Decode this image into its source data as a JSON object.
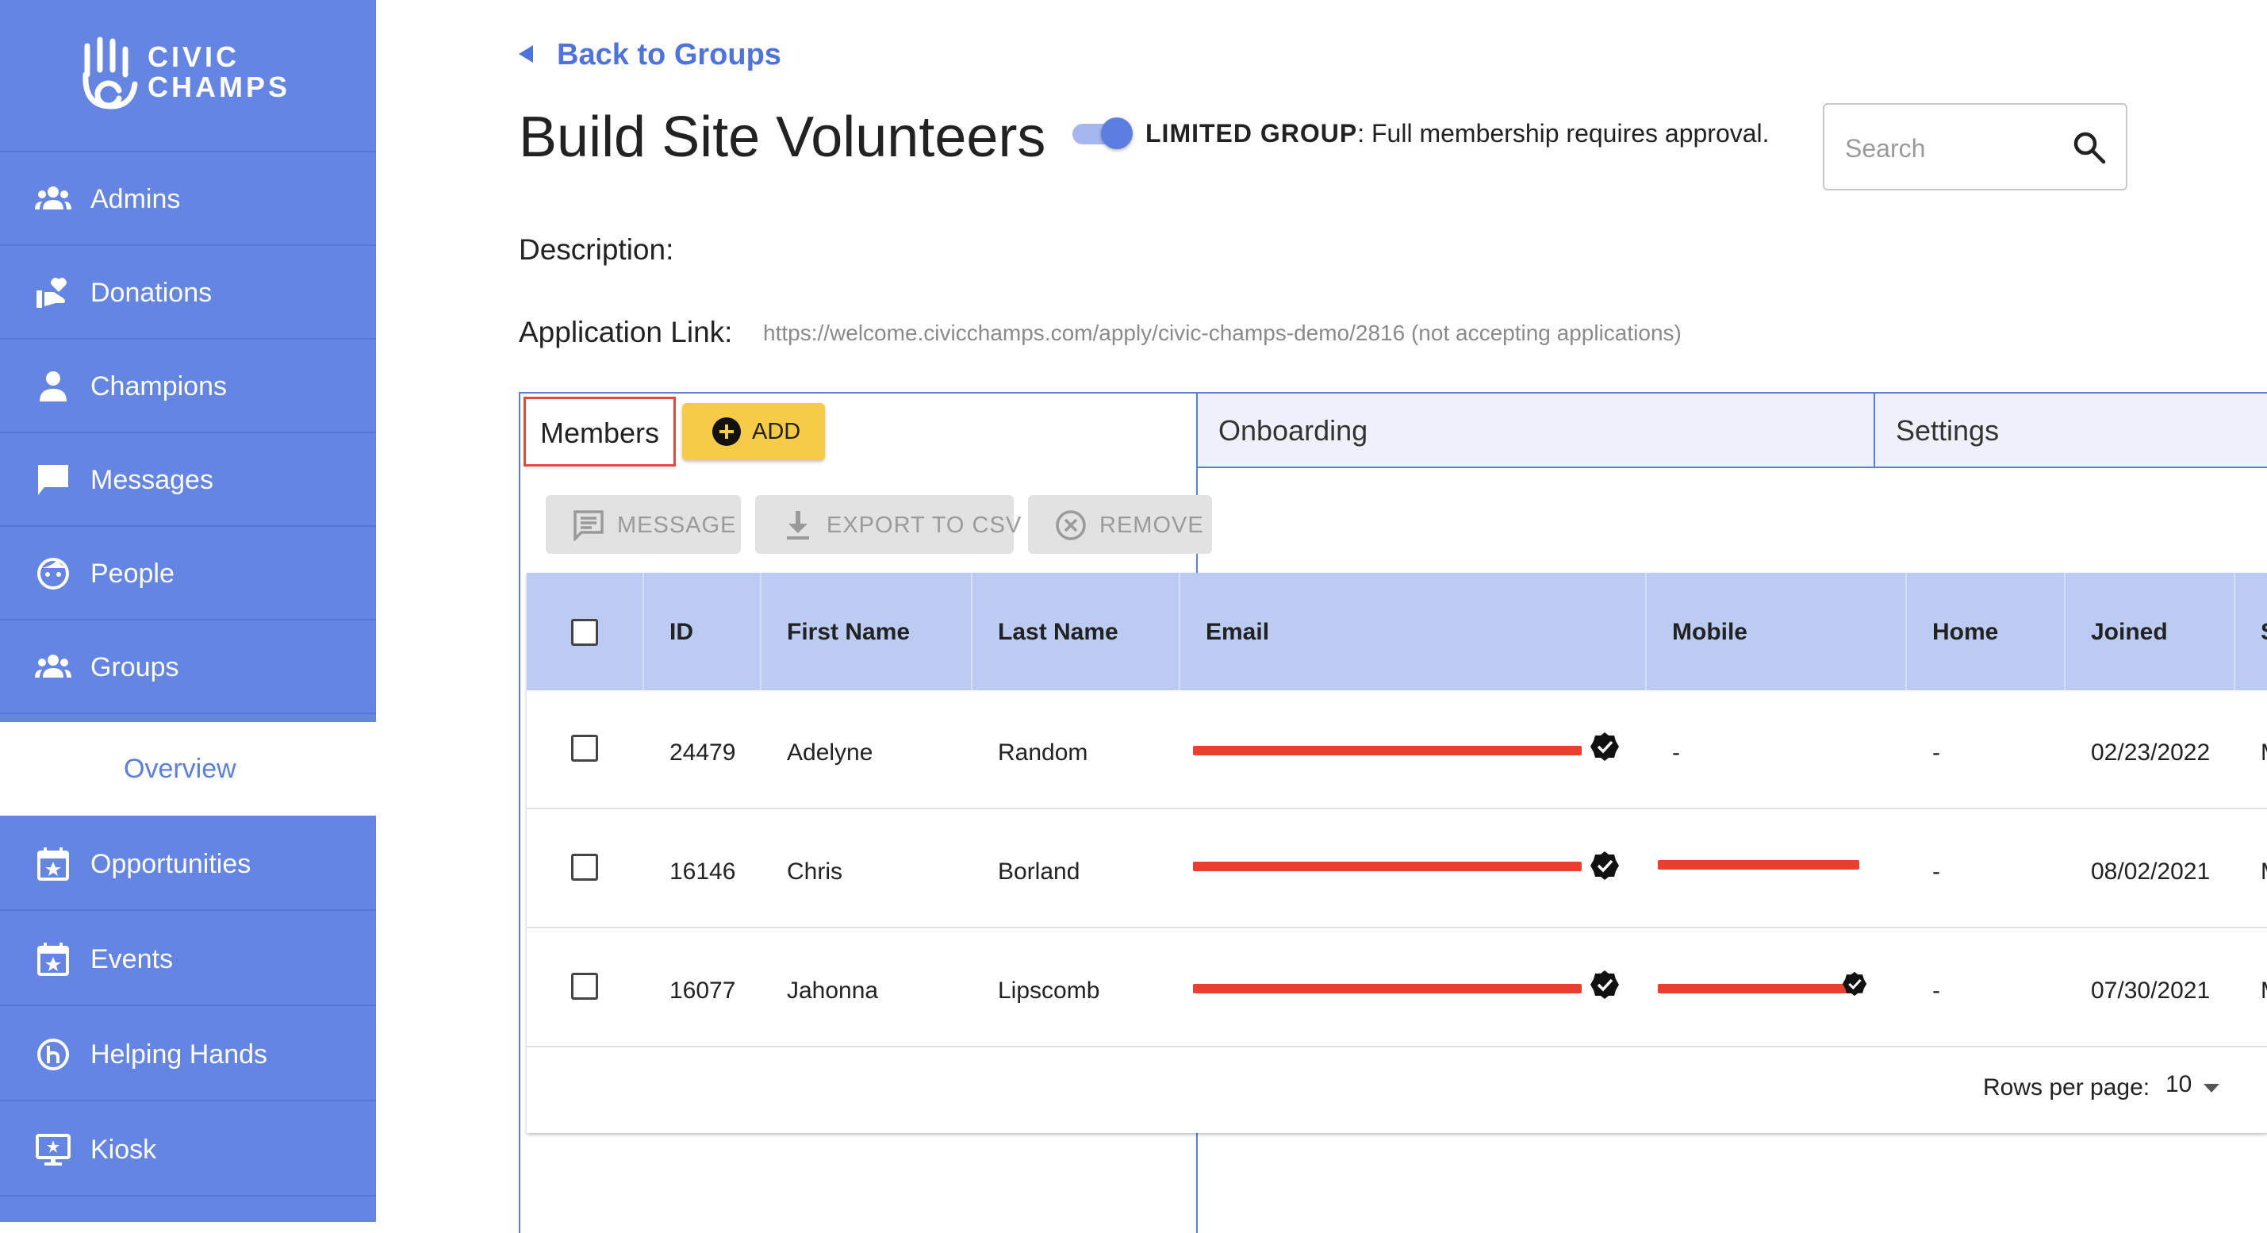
{
  "brand": {
    "line1": "CIVIC",
    "line2": "CHAMPS"
  },
  "sidebar": {
    "items": [
      {
        "label": "Admins",
        "icon": "people-group-icon"
      },
      {
        "label": "Donations",
        "icon": "donation-hand-icon"
      },
      {
        "label": "Champions",
        "icon": "person-icon"
      },
      {
        "label": "Messages",
        "icon": "chat-bubble-icon"
      },
      {
        "label": "People",
        "icon": "face-icon"
      },
      {
        "label": "Groups",
        "icon": "groups-icon"
      },
      {
        "label": "Overview",
        "sub": true
      },
      {
        "label": "Opportunities",
        "icon": "calendar-star-icon"
      },
      {
        "label": "Events",
        "icon": "calendar-star-icon"
      },
      {
        "label": "Helping Hands",
        "icon": "helping-hands-icon"
      },
      {
        "label": "Kiosk",
        "icon": "monitor-icon"
      }
    ]
  },
  "header": {
    "back_label": "Back to Groups",
    "title": "Build Site Volunteers",
    "limited_bold": "LIMITED GROUP",
    "limited_text": ": Full membership requires approval.",
    "search_placeholder": "Search"
  },
  "details": {
    "description_label": "Description:",
    "app_link_label": "Application Link:",
    "app_link_value": "https://welcome.civicchamps.com/apply/civic-champs-demo/2816 (not accepting applications)"
  },
  "tabs": {
    "members": "Members",
    "add": "ADD",
    "onboarding": "Onboarding",
    "settings": "Settings"
  },
  "toolbar": {
    "message": "MESSAGE",
    "export": "EXPORT TO CSV",
    "remove": "REMOVE"
  },
  "table": {
    "columns": [
      "ID",
      "First Name",
      "Last Name",
      "Email",
      "Mobile",
      "Home",
      "Joined",
      "S"
    ],
    "rows": [
      {
        "id": "24479",
        "first": "Adelyne",
        "last": "Random",
        "mobile": "-",
        "home": "-",
        "joined": "02/23/2022",
        "s": "M"
      },
      {
        "id": "16146",
        "first": "Chris",
        "last": "Borland",
        "mobile": "",
        "home": "-",
        "joined": "08/02/2021",
        "s": "M"
      },
      {
        "id": "16077",
        "first": "Jahonna",
        "last": "Lipscomb",
        "mobile": "",
        "home": "-",
        "joined": "07/30/2021",
        "s": "M"
      }
    ],
    "rows_per_page_label": "Rows per page:",
    "rows_per_page_value": "10"
  },
  "colors": {
    "sidebar": "#6585e3",
    "accent": "#5b7fe0",
    "add_button": "#f6cb45",
    "header_row": "#bccbf2",
    "redaction": "#e8402c"
  }
}
